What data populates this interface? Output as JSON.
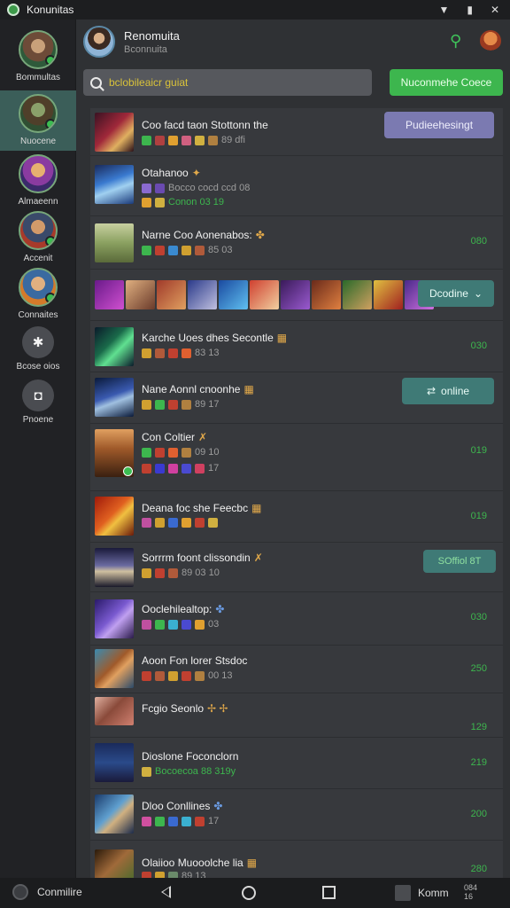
{
  "status_bar": {
    "app_title": "Konunitas",
    "icons": [
      "wifi-icon",
      "battery-icon",
      "close-icon"
    ]
  },
  "sidebar": {
    "items": [
      {
        "label": "Bommultas",
        "active": false
      },
      {
        "label": "Nuocene",
        "active": true
      },
      {
        "label": "Almaeenn",
        "active": false
      },
      {
        "label": "Accenit",
        "active": false
      },
      {
        "label": "Connaites",
        "active": false
      },
      {
        "label": "Bcose oios",
        "icon": "gear-icon",
        "active": false
      },
      {
        "label": "Pnoene",
        "icon": "chat-icon",
        "active": false
      }
    ]
  },
  "header": {
    "title": "Renomuita",
    "subtitle": "Bconnuita"
  },
  "search": {
    "placeholder": "bclobileaicr guiat"
  },
  "top_button": {
    "label": "Nuconmehe Coece"
  },
  "rows": [
    {
      "title": "Coo facd taon Stottonn the",
      "sub1": "89 dfi",
      "sub2": "",
      "value": "",
      "button": "Pudieehesingt",
      "button_style": "purple"
    },
    {
      "title": "Otahanoo",
      "sub1": "Bocco cocd ccd 08",
      "sub2": "Conon 03 19",
      "value": "",
      "button": "",
      "button_style": ""
    },
    {
      "title": "Narne Coo Aonenabos:",
      "sub1": "85 03",
      "sub2": "",
      "value": "080",
      "button": "",
      "button_style": ""
    },
    {
      "title": "",
      "sub1": "",
      "sub2": "",
      "value": "",
      "button": "Dcodine",
      "button_style": "teal-dropdown"
    },
    {
      "title": "Karche Uoes dhes Secontle",
      "sub1": "83 13",
      "sub2": "",
      "value": "030",
      "button": "",
      "button_style": ""
    },
    {
      "title": "Nane Aonnl cnoonhe",
      "sub1": "89 17",
      "sub2": "",
      "value": "",
      "button": "online",
      "button_style": "teal-link"
    },
    {
      "title": "Con Coltier",
      "sub1": "09 10",
      "sub2": "17",
      "value": "019",
      "button": "",
      "button_style": ""
    },
    {
      "title": "Deana foc she Feecbc",
      "sub1": "",
      "sub2": "",
      "value": "019",
      "button": "",
      "button_style": ""
    },
    {
      "title": "Sorrrm foont clissondin",
      "sub1": "89 03 10",
      "sub2": "",
      "value": "",
      "button": "SOffiol 8T",
      "button_style": "teal"
    },
    {
      "title": "Ooclehilealtop:",
      "sub1": "03",
      "sub2": "",
      "value": "030",
      "button": "",
      "button_style": ""
    },
    {
      "title": "Aoon Fon lorer Stsdoc",
      "sub1": "00 13",
      "sub2": "",
      "value": "250",
      "button": "",
      "button_style": ""
    },
    {
      "title": "Fcgio Seonlo",
      "sub1": "",
      "sub2": "",
      "value": "129",
      "button": "",
      "button_style": ""
    },
    {
      "title": "Dioslone Foconclorn",
      "sub1": "Bocoecoa 88 319y",
      "sub2": "",
      "value": "219",
      "button": "",
      "button_style": ""
    },
    {
      "title": "Dloo Conllines",
      "sub1": "17",
      "sub2": "",
      "value": "200",
      "button": "",
      "button_style": ""
    },
    {
      "title": "Olaiioo Muooolche lia",
      "sub1": "89 13",
      "sub2": "",
      "value": "280",
      "button": "",
      "button_style": ""
    }
  ],
  "nav_bar": {
    "left_label": "Conmilire",
    "right_label": "Komm",
    "time": "084\n16"
  },
  "colors": {
    "accent_green": "#3db64e",
    "teal": "#3f7a76",
    "purple": "#7b7ab1",
    "sidebar_active": "#3b5e59"
  }
}
